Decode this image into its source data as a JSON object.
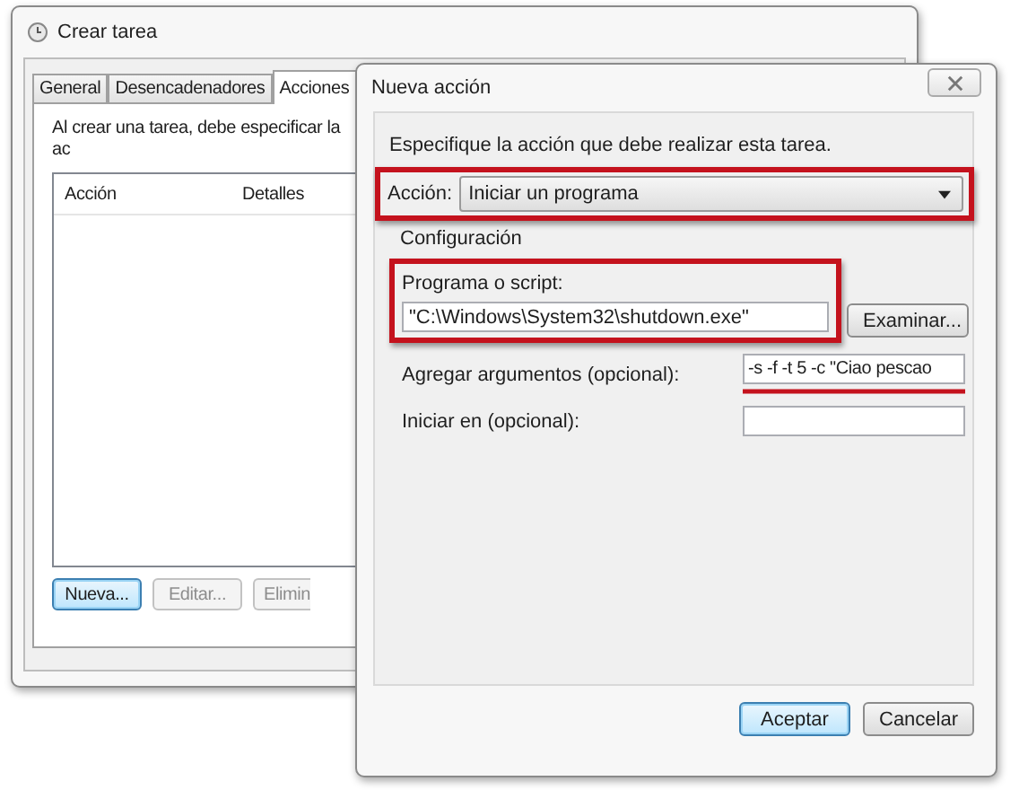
{
  "back_window": {
    "title": "Crear tarea",
    "tabs": [
      {
        "label": "General",
        "selected": false
      },
      {
        "label": "Desencadenadores",
        "selected": false
      },
      {
        "label": "Acciones",
        "selected": true
      }
    ],
    "intro": "Al crear una tarea, debe especificar la ac",
    "list": {
      "columns": [
        "Acción",
        "Detalles"
      ]
    },
    "buttons": [
      {
        "label": "Nueva...",
        "default": true,
        "disabled": false
      },
      {
        "label": "Editar...",
        "default": false,
        "disabled": true
      },
      {
        "label": "Elimin",
        "default": false,
        "disabled": true
      }
    ]
  },
  "dialog": {
    "title": "Nueva acción",
    "instruction": "Especifique la acción que debe realizar esta tarea.",
    "action": {
      "label": "Acción:",
      "value": "Iniciar un programa",
      "highlighted": true
    },
    "group_label": "Configuración",
    "program": {
      "label": "Programa o script:",
      "value": "\"C:\\Windows\\System32\\shutdown.exe\"",
      "highlighted": true
    },
    "browse_button": "Examinar...",
    "arguments": {
      "label": "Agregar argumentos (opcional):",
      "value": "-s -f -t 5 -c \"Ciao pescao",
      "underlined": true
    },
    "start_in": {
      "label": "Iniciar en (opcional):"
    },
    "buttons": [
      {
        "label": "Aceptar",
        "default": true
      },
      {
        "label": "Cancelar",
        "default": false
      }
    ]
  }
}
